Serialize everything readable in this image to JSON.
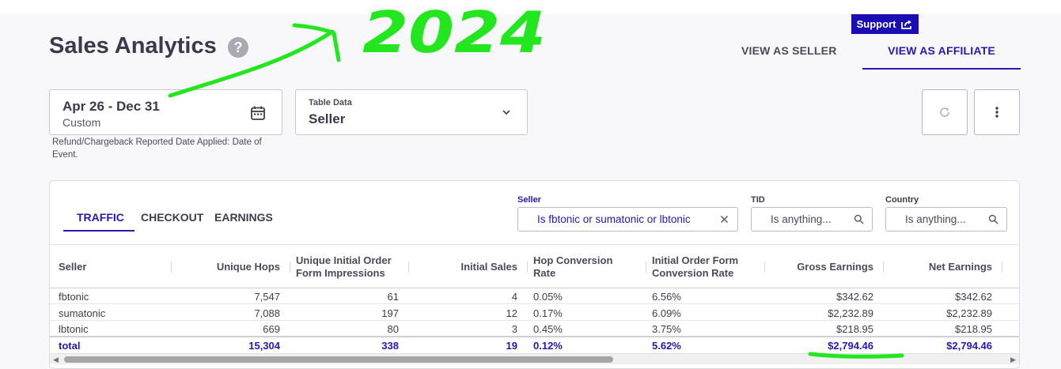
{
  "header": {
    "title": "Sales Analytics",
    "help_glyph": "?",
    "support_label": "Support",
    "view_tabs": [
      {
        "label": "VIEW AS SELLER",
        "active": false
      },
      {
        "label": "VIEW AS AFFILIATE",
        "active": true
      }
    ]
  },
  "controls": {
    "date_range": "Apr 26 - Dec 31",
    "date_mode": "Custom",
    "date_note": "Refund/Chargeback Reported Date Applied: Date of Event.",
    "table_data_label": "Table Data",
    "table_data_value": "Seller"
  },
  "panel": {
    "tabs": [
      {
        "label": "TRAFFIC",
        "active": true
      },
      {
        "label": "CHECKOUT",
        "active": false
      },
      {
        "label": "EARNINGS",
        "active": false
      }
    ],
    "filters": {
      "seller_label": "Seller",
      "seller_value": "Is fbtonic or sumatonic or lbtonic",
      "tid_label": "TID",
      "tid_value": "Is anything...",
      "country_label": "Country",
      "country_value": "Is anything..."
    },
    "table": {
      "headers": [
        "Seller",
        "Unique Hops",
        "Unique Initial Order Form Impressions",
        "Initial Sales",
        "Hop Conversion Rate",
        "Initial Order Form Conversion Rate",
        "Gross Earnings",
        "Net Earnings"
      ],
      "rows": [
        [
          "fbtonic",
          "7,547",
          "61",
          "4",
          "0.05%",
          "6.56%",
          "$342.62",
          "$342.62"
        ],
        [
          "sumatonic",
          "7,088",
          "197",
          "12",
          "0.17%",
          "6.09%",
          "$2,232.89",
          "$2,232.89"
        ],
        [
          "lbtonic",
          "669",
          "80",
          "3",
          "0.45%",
          "3.75%",
          "$218.95",
          "$218.95"
        ]
      ],
      "total": [
        "total",
        "15,304",
        "338",
        "19",
        "0.12%",
        "5.62%",
        "$2,794.46",
        "$2,794.46"
      ]
    }
  },
  "annotation": {
    "handwritten_text": "2024",
    "color": "#22e61e"
  },
  "colors": {
    "accent": "#2817b6",
    "support_bg": "#1a0db4"
  }
}
